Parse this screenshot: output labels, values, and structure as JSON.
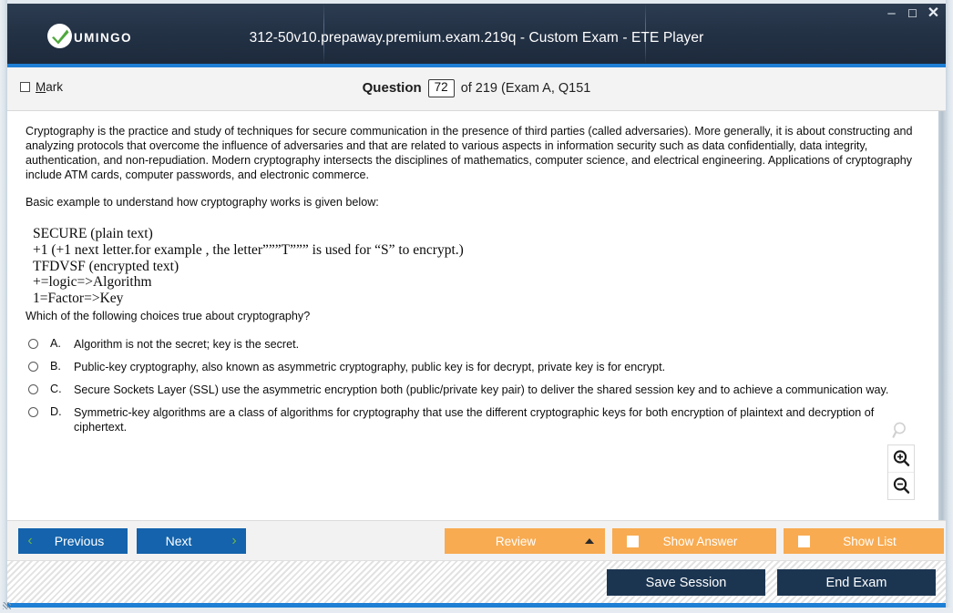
{
  "window": {
    "title": "312-50v10.prepaway.premium.exam.219q - Custom Exam - ETE Player",
    "logo_text": "UMINGO",
    "controls": {
      "minimize": "–",
      "maximize": "☐",
      "close": "✕"
    },
    "accent_blue": "#1e7fd4",
    "titlebar_dark": "#243246"
  },
  "header": {
    "mark_label_accesskey": "M",
    "mark_label_rest": "ark",
    "question_word": "Question",
    "question_number": "72",
    "question_of": "of 219 (Exam A, Q151"
  },
  "content": {
    "intro_paragraph": "Cryptography is the practice and study of techniques for secure communication in the presence of third parties (called adversaries). More generally, it is about constructing and analyzing protocols that overcome the influence of adversaries and that are related to various aspects in information security such as data confidentially, data integrity, authentication, and non-repudiation. Modern cryptography intersects the disciplines of mathematics, computer science, and electrical engineering. Applications of cryptography include ATM cards, computer passwords, and electronic commerce.",
    "basic_example_line": "Basic example to understand how cryptography works is given below:",
    "example_lines": [
      "SECURE (plain text)",
      "+1 (+1 next letter.for example , the letter”””T””” is used for “S” to encrypt.)",
      "TFDVSF (encrypted text)",
      "+=logic=>Algorithm",
      "1=Factor=>Key"
    ],
    "question_prompt": "Which of the following choices true about cryptography?",
    "options": [
      {
        "letter": "A.",
        "text": "Algorithm is not the secret; key is the secret."
      },
      {
        "letter": "B.",
        "text": "Public-key cryptography, also known as asymmetric cryptography, public key is for decrypt, private key is for encrypt."
      },
      {
        "letter": "C.",
        "text": "Secure Sockets Layer (SSL) use the asymmetric encryption both (public/private key pair) to deliver the shared session key and to achieve a communication way."
      },
      {
        "letter": "D.",
        "text": "Symmetric-key algorithms are a class of algorithms for cryptography that use the different cryptographic keys for both encryption of plaintext and decryption of ciphertext."
      }
    ]
  },
  "zoom_tools": {
    "reset_icon": "magnifier-icon",
    "zoom_in_icon": "magnifier-plus-icon",
    "zoom_out_icon": "magnifier-minus-icon"
  },
  "toolbar": {
    "previous_label": "Previous",
    "next_label": "Next",
    "previous_chevron": "‹",
    "next_chevron": "›",
    "review_label": "Review",
    "show_answer_label": "Show Answer",
    "show_list_label": "Show List",
    "blue_button_color": "#1463ac",
    "orange_button_color": "#f8ab51",
    "chevron_color": "#6bb843"
  },
  "bottom_bar": {
    "save_session_label": "Save Session",
    "end_exam_label": "End Exam",
    "dark_button_color": "#1b3551"
  }
}
